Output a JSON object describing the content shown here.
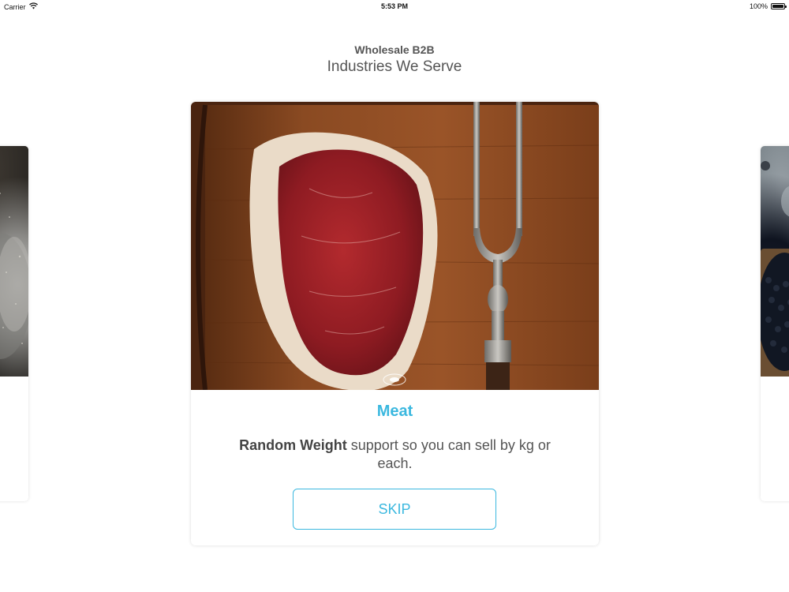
{
  "status_bar": {
    "carrier": "Carrier",
    "time": "5:53 PM",
    "battery": "100%",
    "wifi_icon": "wifi-icon",
    "battery_icon": "battery-icon"
  },
  "header": {
    "subtitle": "Wholesale B2B",
    "title": "Industries We Serve"
  },
  "card": {
    "title": "Meat",
    "description_bold": "Random Weight",
    "description_rest": " support so you can sell by kg or each.",
    "button_label": "SKIP"
  },
  "colors": {
    "accent": "#3bb8df",
    "text": "#555555",
    "background": "#ffffff"
  }
}
